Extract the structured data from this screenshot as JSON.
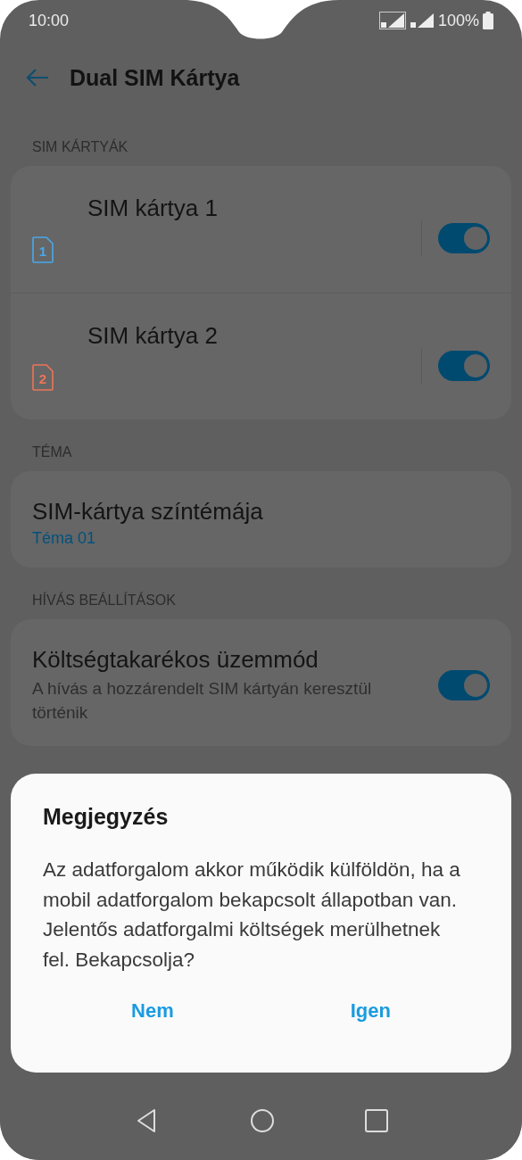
{
  "status_bar": {
    "time": "10:00",
    "battery": "100%"
  },
  "header": {
    "title": "Dual SIM Kártya"
  },
  "sections": [
    {
      "label": "SIM KÁRTYÁK",
      "items": [
        {
          "kind": "sim",
          "title": "SIM kártya 1",
          "sim_number": "1",
          "color": "#4aa8ea",
          "on": true
        },
        {
          "kind": "sim",
          "title": "SIM kártya 2",
          "sim_number": "2",
          "color": "#ee7458",
          "on": true
        }
      ]
    },
    {
      "label": "TÉMA",
      "items": [
        {
          "kind": "value",
          "title": "SIM-kártya színtémája",
          "value": "Téma 01"
        }
      ]
    },
    {
      "label": "HÍVÁS BEÁLLÍTÁSOK",
      "items": [
        {
          "kind": "toggle",
          "title": "Költségtakarékos üzemmód",
          "subtitle": "A hívás a hozzárendelt SIM kártyán keresztül történik",
          "on": true
        }
      ]
    }
  ],
  "dialog": {
    "title": "Megjegyzés",
    "message": "Az adatforgalom akkor működik külföldön, ha a mobil adatforgalom bekapcsolt állapotban van. Jelentős adatforgalmi költségek merülhetnek fel. Bekapcsolja?",
    "buttons": [
      {
        "label": "Nem"
      },
      {
        "label": "Igen"
      }
    ]
  }
}
